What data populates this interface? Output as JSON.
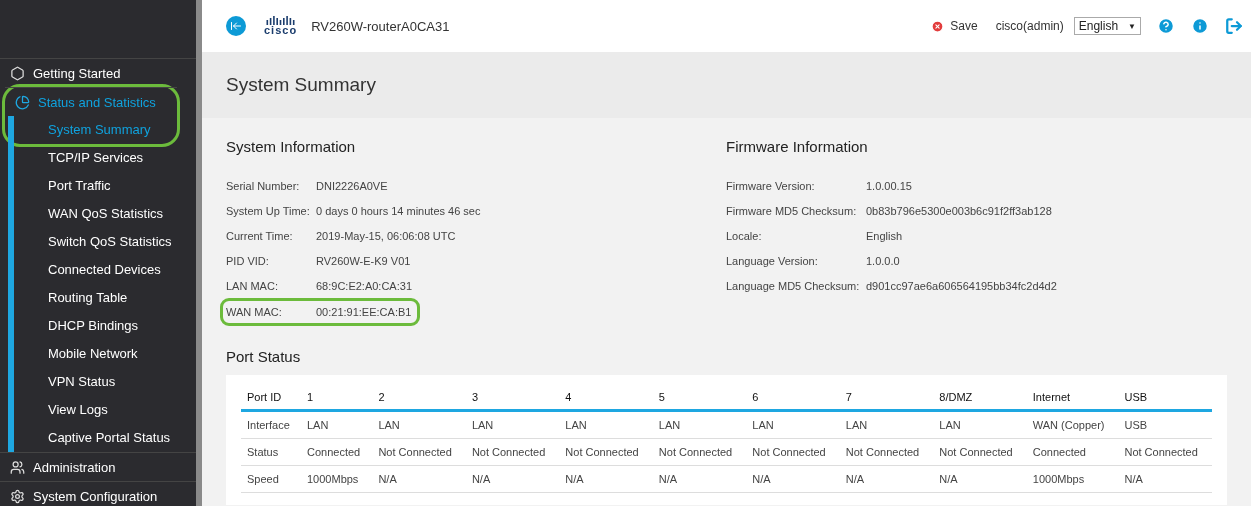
{
  "header": {
    "logo_text": "cisco",
    "device_name": "RV260W-routerA0CA31",
    "save": "Save",
    "user": "cisco(admin)",
    "language": "English",
    "language_caret": "▼"
  },
  "sidebar": {
    "items": [
      {
        "label": "Getting Started",
        "expanded": false,
        "highlighted": false
      },
      {
        "label": "Status and Statistics",
        "expanded": true,
        "highlighted": true,
        "children": [
          {
            "label": "System Summary",
            "selected": true
          },
          {
            "label": "TCP/IP Services",
            "selected": false
          },
          {
            "label": "Port Traffic",
            "selected": false
          },
          {
            "label": "WAN QoS Statistics",
            "selected": false
          },
          {
            "label": "Switch QoS Statistics",
            "selected": false
          },
          {
            "label": "Connected Devices",
            "selected": false
          },
          {
            "label": "Routing Table",
            "selected": false
          },
          {
            "label": "DHCP Bindings",
            "selected": false
          },
          {
            "label": "Mobile Network",
            "selected": false
          },
          {
            "label": "VPN Status",
            "selected": false
          },
          {
            "label": "View Logs",
            "selected": false
          },
          {
            "label": "Captive Portal Status",
            "selected": false
          }
        ]
      },
      {
        "label": "Administration",
        "expanded": false,
        "highlighted": false
      },
      {
        "label": "System Configuration",
        "expanded": false,
        "highlighted": false
      }
    ]
  },
  "page_title": "System Summary",
  "system_information": {
    "title": "System Information",
    "rows": [
      {
        "label": "Serial Number:",
        "value": "DNI2226A0VE",
        "highlighted": false
      },
      {
        "label": "System Up Time:",
        "value": "0 days 0 hours 14 minutes 46 sec",
        "highlighted": false
      },
      {
        "label": "Current Time:",
        "value": "2019-May-15, 06:06:08 UTC",
        "highlighted": false
      },
      {
        "label": "PID VID:",
        "value": "RV260W-E-K9 V01",
        "highlighted": false
      },
      {
        "label": "LAN MAC:",
        "value": "68:9C:E2:A0:CA:31",
        "highlighted": false
      },
      {
        "label": "WAN MAC:",
        "value": "00:21:91:EE:CA:B1",
        "highlighted": true
      }
    ]
  },
  "firmware_information": {
    "title": "Firmware Information",
    "rows": [
      {
        "label": "Firmware Version:",
        "value": "1.0.00.15"
      },
      {
        "label": "Firmware MD5 Checksum:",
        "value": "0b83b796e5300e003b6c91f2ff3ab128"
      },
      {
        "label": "Locale:",
        "value": "English"
      },
      {
        "label": "Language Version:",
        "value": "1.0.0.0"
      },
      {
        "label": "Language MD5 Checksum:",
        "value": "d901cc97ae6a606564195bb34fc2d4d2"
      }
    ]
  },
  "port_status": {
    "title": "Port Status",
    "columns": [
      "Port ID",
      "1",
      "2",
      "3",
      "4",
      "5",
      "6",
      "7",
      "8/DMZ",
      "Internet",
      "USB"
    ],
    "rows": [
      [
        "Interface",
        "LAN",
        "LAN",
        "LAN",
        "LAN",
        "LAN",
        "LAN",
        "LAN",
        "LAN",
        "WAN (Copper)",
        "USB"
      ],
      [
        "Status",
        "Connected",
        "Not Connected",
        "Not Connected",
        "Not Connected",
        "Not Connected",
        "Not Connected",
        "Not Connected",
        "Not Connected",
        "Connected",
        "Not Connected"
      ],
      [
        "Speed",
        "1000Mbps",
        "N/A",
        "N/A",
        "N/A",
        "N/A",
        "N/A",
        "N/A",
        "N/A",
        "1000Mbps",
        "N/A"
      ]
    ]
  }
}
